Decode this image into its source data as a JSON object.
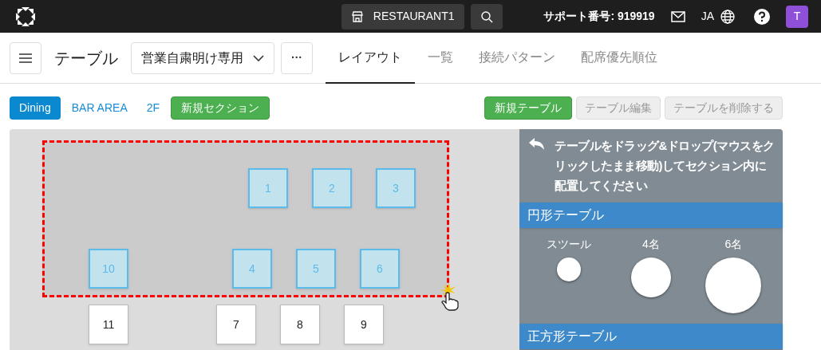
{
  "topbar": {
    "store": "RESTAURANT1",
    "support": "サポート番号: 919919",
    "language": "JA",
    "avatar": "T"
  },
  "toolbar": {
    "title": "テーブル",
    "dropdown": "営業自粛明け専用",
    "more": "···",
    "tabs": [
      {
        "label": "レイアウト",
        "selected": true
      },
      {
        "label": "一覧",
        "selected": false
      },
      {
        "label": "接続パターン",
        "selected": false
      },
      {
        "label": "配席優先順位",
        "selected": false
      }
    ]
  },
  "sections": [
    {
      "label": "Dining",
      "selected": true
    },
    {
      "label": "BAR AREA",
      "selected": false
    },
    {
      "label": "2F",
      "selected": false
    }
  ],
  "new_section": "新規セクション",
  "actions": [
    {
      "label": "新規テーブル",
      "disabled": false
    },
    {
      "label": "テーブル編集",
      "disabled": true
    },
    {
      "label": "テーブルを削除する",
      "disabled": true
    }
  ],
  "tables": [
    {
      "label": "1",
      "selected": true
    },
    {
      "label": "2",
      "selected": true
    },
    {
      "label": "3",
      "selected": true
    },
    {
      "label": "10",
      "selected": true
    },
    {
      "label": "4",
      "selected": true
    },
    {
      "label": "5",
      "selected": true
    },
    {
      "label": "6",
      "selected": true
    },
    {
      "label": "11",
      "selected": false
    },
    {
      "label": "7",
      "selected": false
    },
    {
      "label": "8",
      "selected": false
    },
    {
      "label": "9",
      "selected": false
    }
  ],
  "palette": {
    "instruction": "テーブルをドラッグ&ドロップ(マウスをクリックしたまま移動)してセクション内に配置してください",
    "groups": [
      {
        "title": "円形テーブル",
        "items": [
          {
            "label": "スツール"
          },
          {
            "label": "4名"
          },
          {
            "label": "6名"
          }
        ]
      },
      {
        "title": "正方形テーブル"
      }
    ]
  }
}
